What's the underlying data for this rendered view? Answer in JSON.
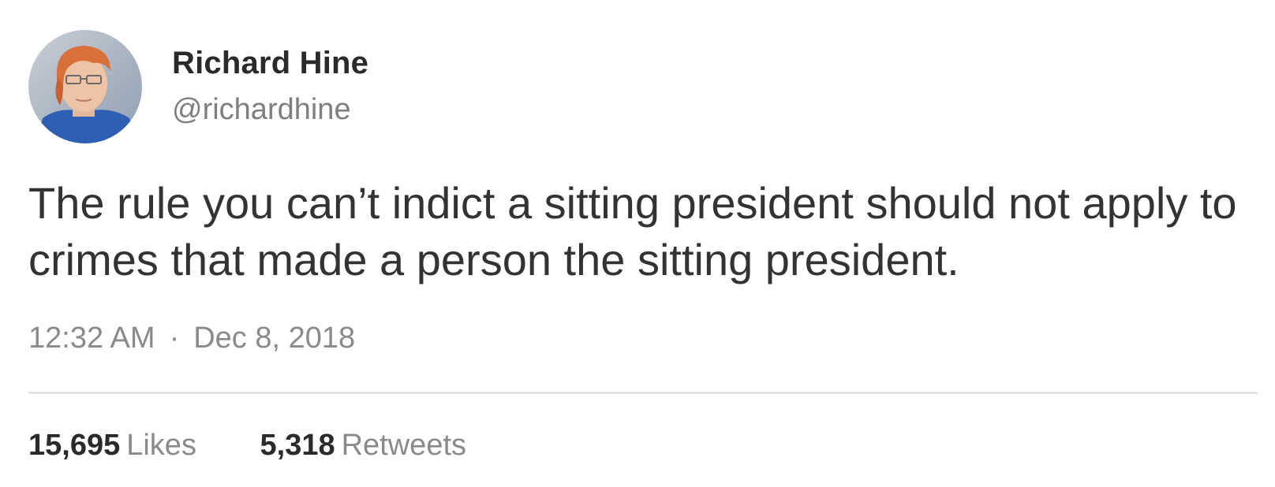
{
  "author": {
    "display_name": "Richard Hine",
    "handle": "@richardhine",
    "avatar_icon": "profile-photo"
  },
  "tweet": {
    "text": "The rule you can’t indict a sitting president should not apply to crimes that made a person the sitting president.",
    "time": "12:32 AM",
    "separator": "·",
    "date": "Dec 8, 2018"
  },
  "stats": {
    "likes_count": "15,695",
    "likes_label": "Likes",
    "retweets_count": "5,318",
    "retweets_label": "Retweets"
  },
  "colors": {
    "text": "#333333",
    "secondary": "#8a8a8a",
    "divider": "#e4e4e4"
  }
}
